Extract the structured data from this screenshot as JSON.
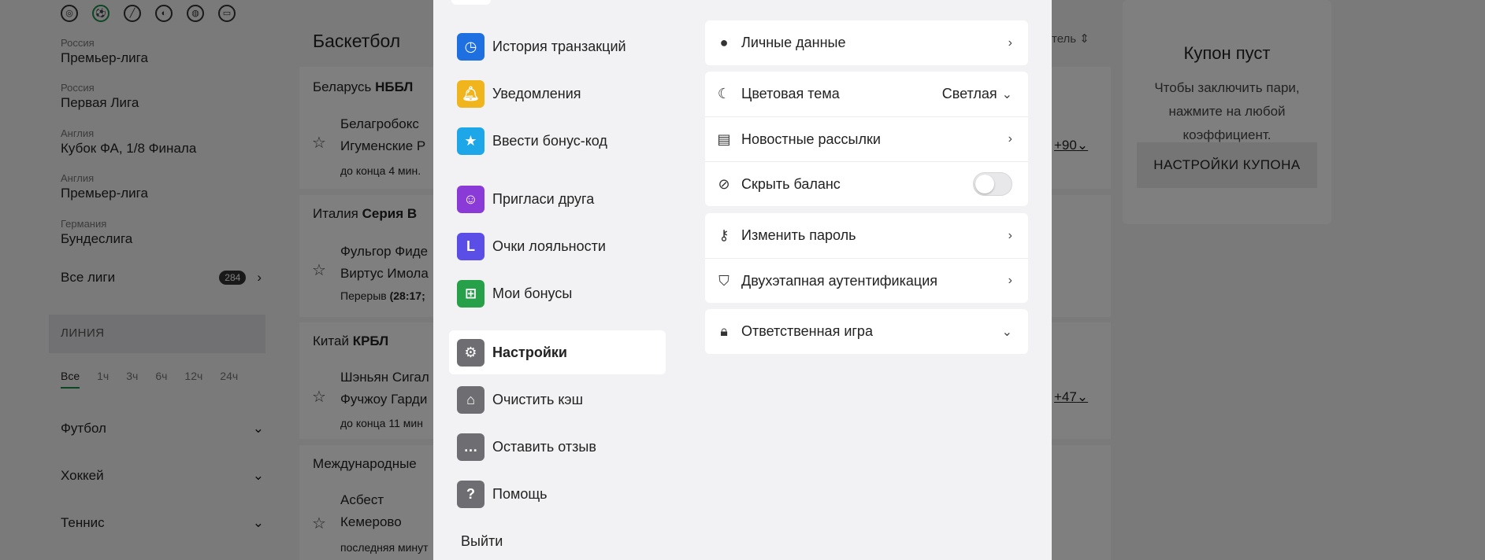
{
  "sidebar": {
    "sport_icons": [
      "compass-icon",
      "football-icon",
      "hockey-icon",
      "tennis-icon",
      "basketball-icon",
      "gamepad-icon"
    ],
    "leagues": [
      {
        "country": "Россия",
        "name": "Премьер-лига"
      },
      {
        "country": "Россия",
        "name": "Первая Лига"
      },
      {
        "country": "Англия",
        "name": "Кубок ФА, 1/8 Финала"
      },
      {
        "country": "Англия",
        "name": "Премьер-лига"
      },
      {
        "country": "Германия",
        "name": "Бундеслига"
      }
    ],
    "all_leagues_label": "Все лиги",
    "all_leagues_count": "284",
    "line_label": "ЛИНИЯ",
    "periods": [
      "Все",
      "1ч",
      "3ч",
      "6ч",
      "12ч",
      "24ч"
    ],
    "sports": [
      "Футбол",
      "Хоккей",
      "Теннис"
    ]
  },
  "main": {
    "title": "Баскетбол",
    "sort_label": "тель",
    "events": [
      {
        "league_prefix": "Беларусь",
        "league": "НББЛ",
        "team1": "Белагробокс",
        "team2": "Игуменские Р",
        "status": "до конца 4 мин.",
        "odds": "+90"
      },
      {
        "league_prefix": "Италия",
        "league": "Серия B",
        "team1": "Фульгор Фиде",
        "team2": "Виртус Имола",
        "status": "Перерыв",
        "status2": "(28:17;",
        "odds": ""
      },
      {
        "league_prefix": "Китай",
        "league": "КРБЛ",
        "team1": "Шэньян Сигал",
        "team2": "Фучжоу Гарди",
        "status": "до конца 11 мин",
        "odds": "+47"
      },
      {
        "league_prefix": "Международные",
        "league": "",
        "team1": "Асбест",
        "team2": "Кемерово",
        "status": "последняя минут",
        "odds": ""
      }
    ]
  },
  "coupon": {
    "title": "Купон пуст",
    "desc": "Чтобы заключить пари, нажмите на любой коэффициент.",
    "button": "НАСТРОЙКИ КУПОНА"
  },
  "modal": {
    "menu": [
      {
        "label": "История транзакций",
        "icon": "clock-icon",
        "color": "#1e6fe0"
      },
      {
        "label": "Уведомления",
        "icon": "bell-icon",
        "color": "#f0b41c"
      },
      {
        "label": "Ввести бонус-код",
        "icon": "ticket-icon",
        "color": "#1ea7e8"
      },
      {
        "label": "Пригласи друга",
        "icon": "friends-icon",
        "color": "#8a3ad6"
      },
      {
        "label": "Очки лояльности",
        "icon": "loyalty-icon",
        "color": "#5a4ee6"
      },
      {
        "label": "Мои бонусы",
        "icon": "gift-icon",
        "color": "#27a04a"
      },
      {
        "label": "Настройки",
        "icon": "gear-icon",
        "color": "#6e6e72"
      },
      {
        "label": "Очистить кэш",
        "icon": "broom-icon",
        "color": "#6e6e72"
      },
      {
        "label": "Оставить отзыв",
        "icon": "chat-icon",
        "color": "#6e6e72"
      },
      {
        "label": "Помощь",
        "icon": "help-icon",
        "color": "#6e6e72"
      }
    ],
    "logout": "Выйти",
    "settings": {
      "personal": "Личные данные",
      "theme": "Цветовая тема",
      "theme_value": "Светлая",
      "newsletters": "Новостные рассылки",
      "hide_balance": "Скрыть баланс",
      "change_password": "Изменить пароль",
      "two_factor": "Двухэтапная аутентификация",
      "responsible": "Ответственная игра"
    }
  }
}
